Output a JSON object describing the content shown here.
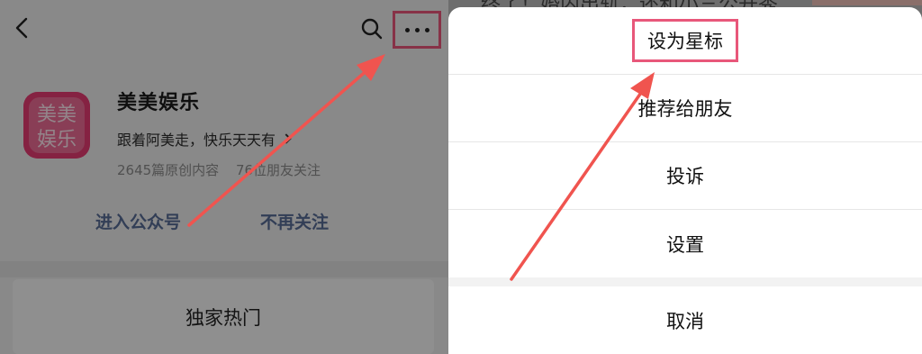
{
  "account": {
    "name": "美美娱乐",
    "logo_text_top": "美美",
    "logo_text_bottom": "娱乐",
    "description": "跟着阿美走，快乐天天有",
    "original_count": "2645篇原创内容",
    "friends_following": "76位朋友关注"
  },
  "actions": {
    "enter_label": "进入公众号",
    "unfollow_label": "不再关注"
  },
  "card": {
    "label": "独家热门"
  },
  "background_headline": "终了！婚内出轨，还和小三公开秀",
  "sheet": {
    "star_label": "设为星标",
    "recommend_label": "推荐给朋友",
    "report_label": "投诉",
    "settings_label": "设置",
    "cancel_label": "取消"
  },
  "icons": {
    "back": "chevron-left-icon",
    "search": "search-icon",
    "more": "more-dots-icon"
  },
  "colors": {
    "highlight": "#e8577a",
    "arrow": "#f0544f",
    "link": "#576b95",
    "logo": "#e63c73"
  }
}
